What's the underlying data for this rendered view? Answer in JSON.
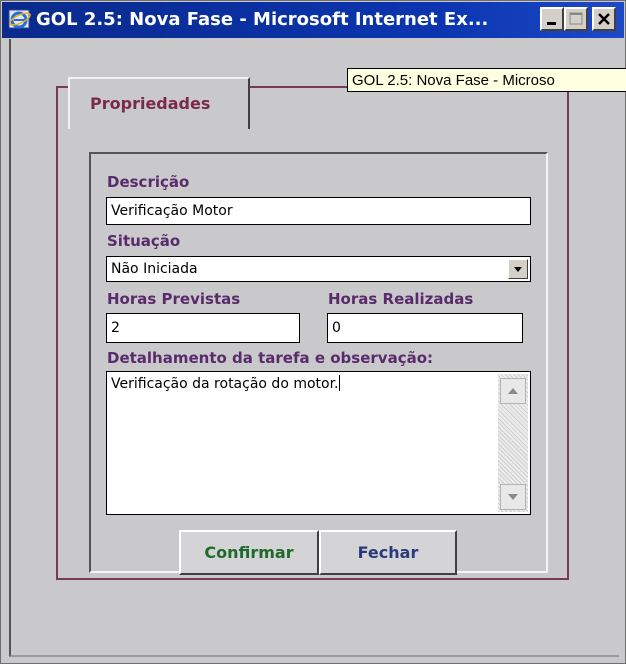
{
  "window": {
    "title": "GOL 2.5: Nova Fase - Microsoft Internet Ex...",
    "tooltip": "GOL 2.5: Nova Fase - Microso",
    "icon": "internet-explorer-icon"
  },
  "tab": {
    "label": "Propriedades"
  },
  "form": {
    "descricao_label": "Descrição",
    "descricao_value": "Verificação Motor",
    "situacao_label": "Situação",
    "situacao_value": "Não Iniciada",
    "horas_previstas_label": "Horas Previstas",
    "horas_previstas_value": "2",
    "horas_realizadas_label": "Horas Realizadas",
    "horas_realizadas_value": "0",
    "detalhamento_label": "Detalhamento da tarefa e observação:",
    "detalhamento_value": "Verificação da rotação do motor."
  },
  "buttons": {
    "confirm_label": "Confirmar",
    "close_label": "Fechar"
  },
  "colors": {
    "title_bar": "#0b35b0",
    "label_text": "#5a2b6b",
    "tab_text": "#7a2a4a",
    "confirm_text": "#1f6a2a",
    "close_text": "#2a3a7a",
    "panel_background": "#c9c9cc"
  }
}
